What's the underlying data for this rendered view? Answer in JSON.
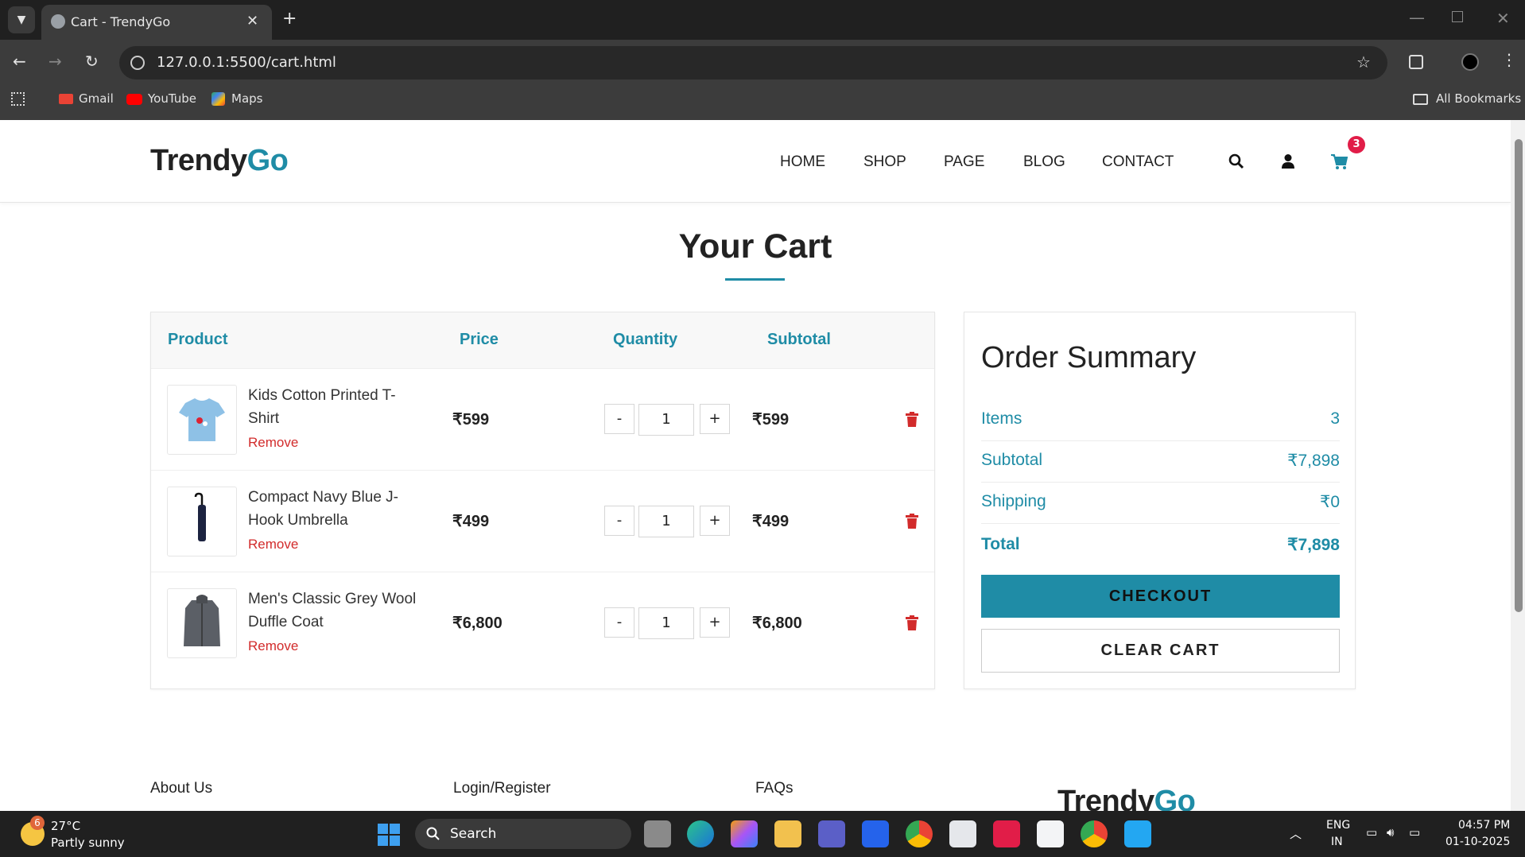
{
  "browser": {
    "tab_title": "Cart - TrendyGo",
    "url": "127.0.0.1:5500/cart.html",
    "bookmarks": [
      "Gmail",
      "YouTube",
      "Maps"
    ],
    "all_bookmarks": "All Bookmarks"
  },
  "site": {
    "logo_part1": "Trendy",
    "logo_part2": "Go",
    "menu": [
      "HOME",
      "SHOP",
      "PAGE",
      "BLOG",
      "CONTACT"
    ],
    "cart_count": "3"
  },
  "page_title": "Your Cart",
  "table": {
    "headers": [
      "Product",
      "Price",
      "Quantity",
      "Subtotal"
    ],
    "rows": [
      {
        "name": "Kids Cotton Printed T-Shirt",
        "remove": "Remove",
        "price": "₹599",
        "qty": "1",
        "subtotal": "₹599"
      },
      {
        "name": "Compact Navy Blue J-Hook Umbrella",
        "remove": "Remove",
        "price": "₹499",
        "qty": "1",
        "subtotal": "₹499"
      },
      {
        "name": "Men's Classic Grey Wool Duffle Coat",
        "remove": "Remove",
        "price": "₹6,800",
        "qty": "1",
        "subtotal": "₹6,800"
      }
    ],
    "minus": "-",
    "plus": "+"
  },
  "summary": {
    "title": "Order Summary",
    "items_label": "Items",
    "items_value": "3",
    "subtotal_label": "Subtotal",
    "subtotal_value": "₹7,898",
    "shipping_label": "Shipping",
    "shipping_value": "₹0",
    "total_label": "Total",
    "total_value": "₹7,898",
    "checkout": "CHECKOUT",
    "clear": "CLEAR CART"
  },
  "footer": {
    "links": [
      "About Us",
      "Login/Register",
      "FAQs"
    ],
    "logo_part1": "Trendy",
    "logo_part2": "Go"
  },
  "taskbar": {
    "temp": "27°C",
    "weather": "Partly sunny",
    "weather_badge": "6",
    "search": "Search",
    "lang1": "ENG",
    "lang2": "IN",
    "time": "04:57 PM",
    "date": "01-10-2025"
  },
  "colors": {
    "accent": "#1f8ca6",
    "danger": "#d22b2b"
  }
}
